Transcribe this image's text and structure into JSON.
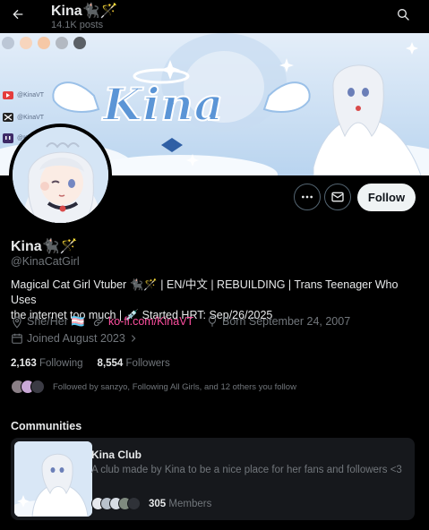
{
  "header": {
    "title": "Kina🐈‍⬛🪄",
    "posts_count": "14.1K posts",
    "icons": {
      "back": "back-arrow-icon",
      "search": "search-icon"
    }
  },
  "banner": {
    "wordmark": "Kina",
    "social_tags": [
      "@KinaVT",
      "@KinaVT",
      "@KinaVT"
    ],
    "swatch_colors": [
      "#bcc7d6",
      "#f7d5bd",
      "#f6c8a6",
      "#b3b9c2",
      "#5b6066"
    ]
  },
  "actions": {
    "more_icon": "more-icon",
    "message_icon": "envelope-icon",
    "follow_label": "Follow"
  },
  "profile": {
    "display_name": "Kina🐈‍⬛🪄",
    "handle": "@KinaCatGirl",
    "bio_line1": "Magical Cat Girl Vtuber 🐈‍⬛🪄 | EN/中文 | REBUILDING | Trans Teenager Who Uses",
    "bio_line2": "the internet too much | 💉 Started HRT: Sep/26/2025",
    "pronouns": "She/Her 🏳️‍⚧️",
    "website": "ko-fi.com/KinaVT",
    "birthday": "Born September 24, 2007",
    "joined": "Joined August 2023",
    "following_count": "2,163",
    "following_label": "Following",
    "followers_count": "8,554",
    "followers_label": "Followers",
    "followed_by": "Followed by sanzyo, Following All Girls, and 12 others you follow"
  },
  "communities": {
    "section_title": "Communities",
    "items": [
      {
        "name": "Kina Club",
        "description": "A club made by Kina to be a nice place for her fans and followers <3",
        "member_count": "305",
        "member_label": "Members"
      }
    ]
  },
  "colors": {
    "background": "#000000",
    "text": "#e7e9ea",
    "muted": "#71767b",
    "link": "#ff4fa0",
    "card": "#16181c"
  }
}
